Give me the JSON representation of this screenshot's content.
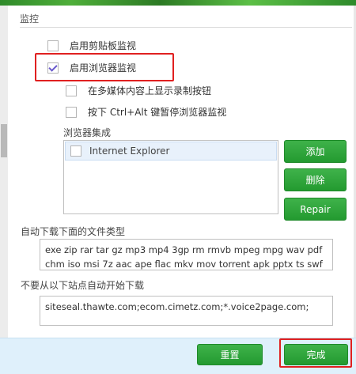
{
  "section": {
    "title": "监控"
  },
  "options": {
    "clipboard_label": "启用剪贴板监视",
    "clipboard_checked": false,
    "browser_label": "启用浏览器监视",
    "browser_checked": true,
    "multimedia_label": "在多媒体内容上显示录制按钮",
    "multimedia_checked": false,
    "pause_label": "按下 Ctrl+Alt 键暂停浏览器监视",
    "pause_checked": false
  },
  "browser_integration": {
    "label": "浏览器集成",
    "items": [
      {
        "label": "Internet Explorer",
        "checked": false
      }
    ],
    "add_label": "添加",
    "delete_label": "删除",
    "repair_label": "Repair"
  },
  "auto_download": {
    "label": "自动下载下面的文件类型",
    "value": "exe zip rar tar gz mp3 mp4 3gp rm rmvb mpeg mpg wav pdf chm iso msi 7z aac ape flac mkv mov torrent apk pptx ts swf"
  },
  "exclude_sites": {
    "label": "不要从以下站点自动开始下载",
    "value": "siteseal.thawte.com;ecom.cimetz.com;*.voice2page.com;"
  },
  "footer": {
    "reset_label": "重置",
    "done_label": "完成"
  },
  "colors": {
    "accent_green": "#2aa338",
    "highlight_red": "#e02020",
    "footer_bg": "#dff0fb"
  }
}
